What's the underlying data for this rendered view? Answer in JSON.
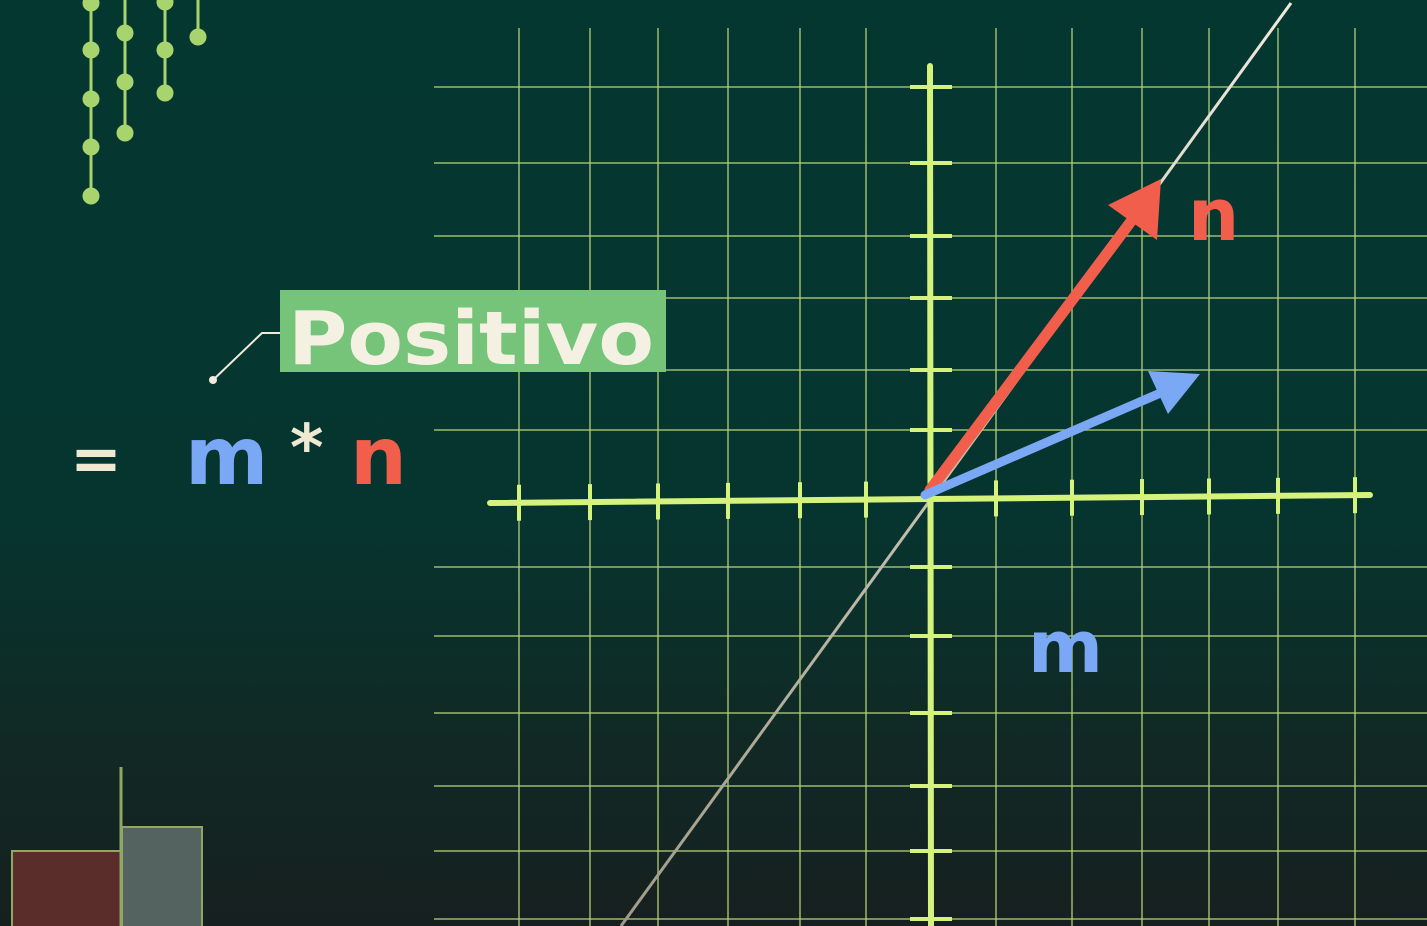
{
  "formula": {
    "equals": "=",
    "left": "m",
    "operator": "*",
    "right": "n"
  },
  "callout": {
    "label": "Positivo"
  },
  "vectors": {
    "n_label": "n",
    "m_label": "m"
  },
  "colors": {
    "background": "#053731",
    "grid": "#b4d27a",
    "axis": "#d4f27c",
    "vector_n": "#f15e4b",
    "vector_m": "#7aa8f4",
    "callout_bg": "#76c47a",
    "callout_text": "#f4f1e2",
    "equals": "#efe9d2",
    "line": "#e7e2cf",
    "bar_red": "#5a2d2a",
    "bar_gray": "#546360"
  }
}
